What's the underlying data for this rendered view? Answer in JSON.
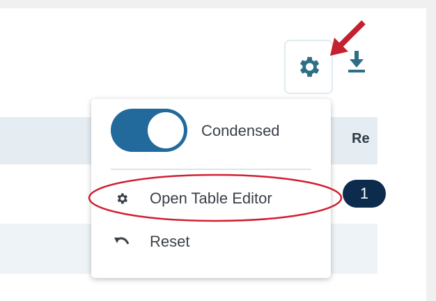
{
  "table": {
    "column_header_partial": "Re"
  },
  "toolbar": {
    "settings_icon": "gear-icon",
    "download_icon": "download-icon"
  },
  "menu": {
    "toggle": {
      "label": "Condensed",
      "state": "on"
    },
    "items": [
      {
        "label": "Open Table Editor",
        "icon": "gear-icon"
      },
      {
        "label": "Reset",
        "icon": "undo-icon"
      }
    ]
  },
  "annotation": {
    "step_number": "1"
  },
  "colors": {
    "accent": "#236a9c",
    "icon_teal": "#2e6f86",
    "annotation_red": "#d01f2f",
    "badge_navy": "#0d2b4c"
  }
}
